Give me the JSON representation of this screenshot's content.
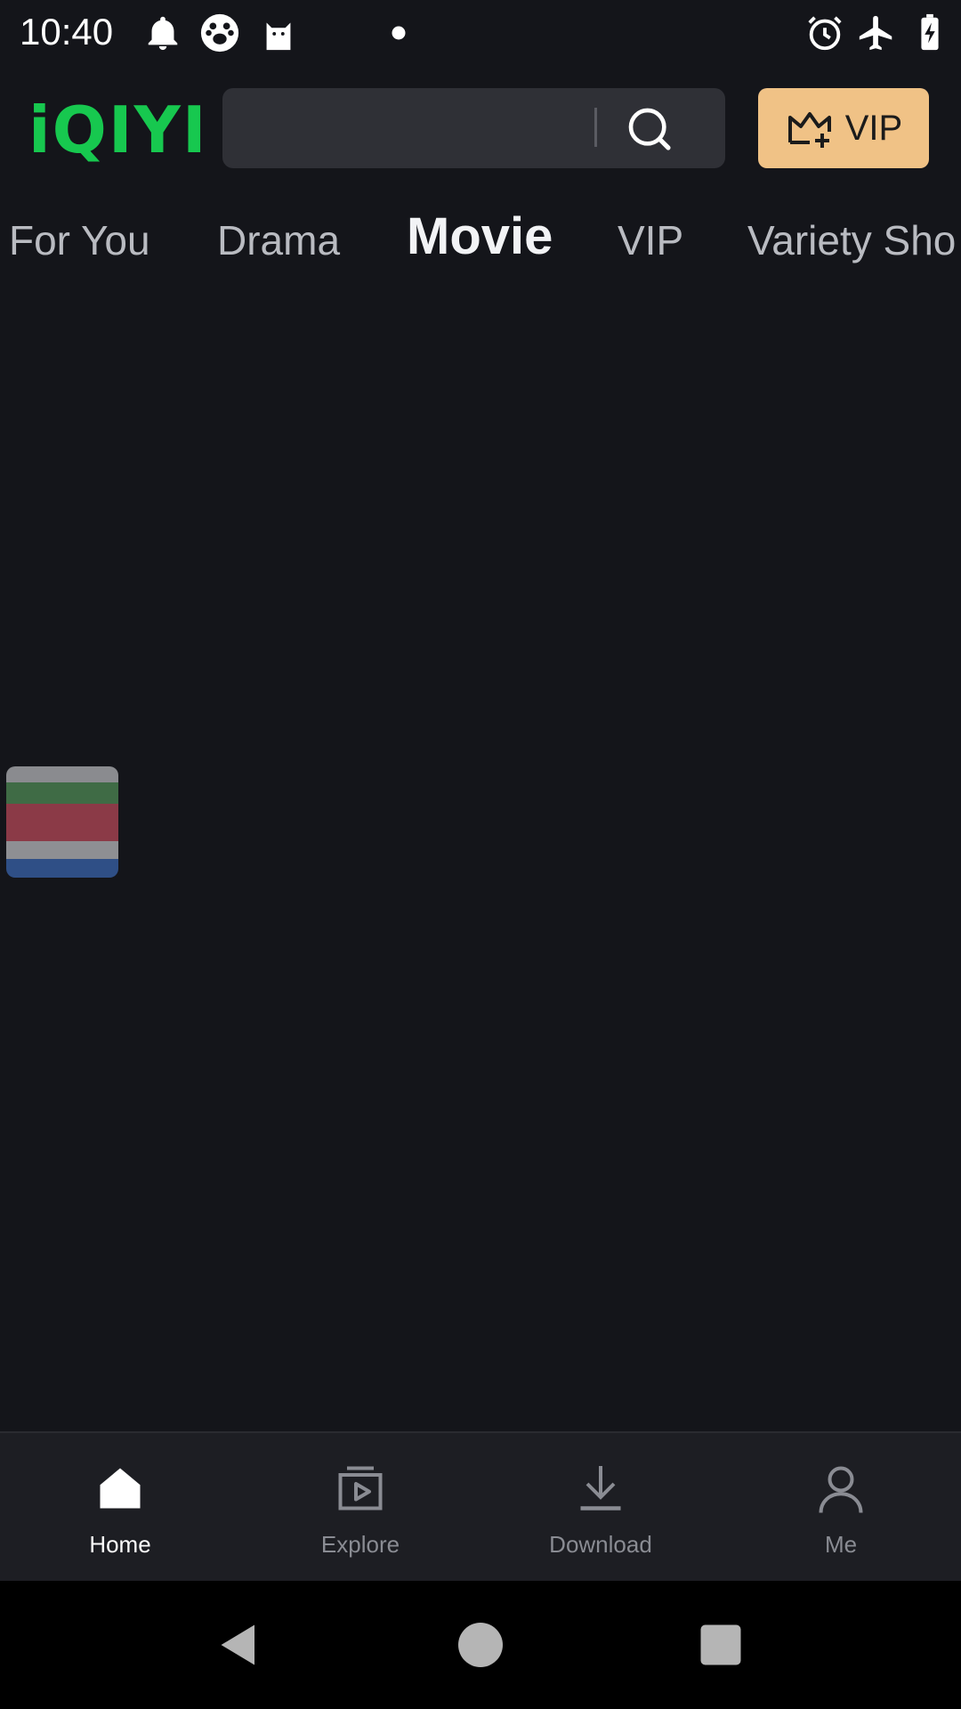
{
  "status_bar": {
    "time": "10:40",
    "left_icons": [
      "bell-icon",
      "paw-icon",
      "cat-icon",
      "dot-icon"
    ],
    "right_icons": [
      "alarm-icon",
      "airplane-icon",
      "battery-charging-icon"
    ]
  },
  "header": {
    "logo_text": "iQIYI",
    "search_placeholder": "",
    "vip_label": "VIP",
    "colors": {
      "logo": "#17c84f",
      "vip_bg": "#f0c286",
      "search_bg": "#2f3036"
    }
  },
  "tabs": [
    {
      "label": "For You",
      "active": false
    },
    {
      "label": "Drama",
      "active": false
    },
    {
      "label": "Movie",
      "active": true
    },
    {
      "label": "VIP",
      "active": false
    },
    {
      "label": "Variety Sho",
      "active": false
    }
  ],
  "floating_thumbnail": {
    "colors": [
      "#8a8b8f",
      "#3f6b45",
      "#8b3a47",
      "#8e8f93",
      "#2f4f86"
    ]
  },
  "bottom_nav": [
    {
      "label": "Home",
      "icon": "home-icon",
      "active": true
    },
    {
      "label": "Explore",
      "icon": "explore-icon",
      "active": false
    },
    {
      "label": "Download",
      "icon": "download-icon",
      "active": false
    },
    {
      "label": "Me",
      "icon": "profile-icon",
      "active": false
    }
  ],
  "system_nav": [
    "back-icon",
    "home-circle-icon",
    "recents-icon"
  ]
}
